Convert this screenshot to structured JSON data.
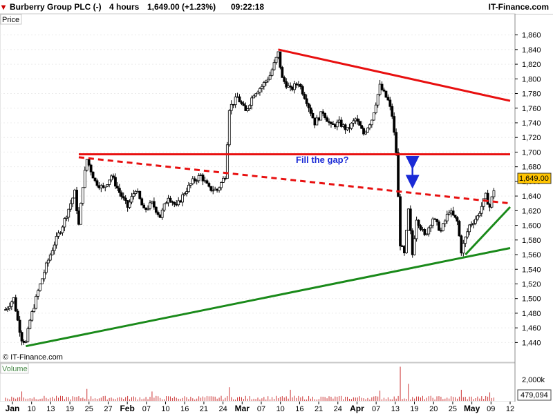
{
  "header": {
    "title": "Burberry Group PLC (-)",
    "timeframe": "4 hours",
    "last": "1,649.00 (+1.23%)",
    "time": "09:22:18",
    "brand": "IT-Finance.com"
  },
  "price_panel": {
    "label": "Price",
    "watermark": "© IT-Finance.com",
    "current_price": "1,649.00",
    "annotation": "Fill the gap?"
  },
  "volume_panel": {
    "label": "Volume",
    "scale_label": "2,000k",
    "current_volume": "479,094"
  },
  "colors": {
    "resistance": "#e81010",
    "support": "#1a8a1a",
    "arrow": "#1a2ad6",
    "annotation": "#1a2ad6",
    "bull_candle": "#ffffff",
    "bear_candle": "#000000",
    "volume_bar": "#cc3333",
    "price_badge": "#ffc400"
  },
  "chart_data": {
    "type": "candlestick",
    "title": "Burberry Group PLC (-)",
    "interval": "4 hours",
    "ylim": [
      1430,
      1870
    ],
    "y_ticks": [
      "1,440",
      "1,460",
      "1,480",
      "1,500",
      "1,520",
      "1,540",
      "1,560",
      "1,580",
      "1,600",
      "1,620",
      "1,640",
      "1,660",
      "1,680",
      "1,700",
      "1,720",
      "1,740",
      "1,760",
      "1,780",
      "1,800",
      "1,820",
      "1,840",
      "1,860"
    ],
    "x_ticks": [
      {
        "label": "Jan",
        "bold": true
      },
      {
        "label": "10"
      },
      {
        "label": "13"
      },
      {
        "label": "19"
      },
      {
        "label": "25"
      },
      {
        "label": "27"
      },
      {
        "label": "Feb",
        "bold": true
      },
      {
        "label": "07"
      },
      {
        "label": "10"
      },
      {
        "label": "16"
      },
      {
        "label": "21"
      },
      {
        "label": "24"
      },
      {
        "label": "Mar",
        "bold": true
      },
      {
        "label": "07"
      },
      {
        "label": "10"
      },
      {
        "label": "16"
      },
      {
        "label": "21"
      },
      {
        "label": "24"
      },
      {
        "label": "Apr",
        "bold": true
      },
      {
        "label": "07"
      },
      {
        "label": "13"
      },
      {
        "label": "19"
      },
      {
        "label": "20"
      },
      {
        "label": "25"
      },
      {
        "label": "May",
        "bold": true
      },
      {
        "label": "09"
      },
      {
        "label": "12"
      }
    ],
    "price_path": [
      {
        "t": 0,
        "p": 1485
      },
      {
        "t": 2,
        "p": 1500
      },
      {
        "t": 3,
        "p": 1470
      },
      {
        "t": 4,
        "p": 1445
      },
      {
        "t": 5,
        "p": 1440
      },
      {
        "t": 6,
        "p": 1470
      },
      {
        "t": 8,
        "p": 1510
      },
      {
        "t": 10,
        "p": 1545
      },
      {
        "t": 12,
        "p": 1575
      },
      {
        "t": 14,
        "p": 1600
      },
      {
        "t": 16,
        "p": 1630
      },
      {
        "t": 17,
        "p": 1645
      },
      {
        "t": 18,
        "p": 1600
      },
      {
        "t": 19,
        "p": 1655
      },
      {
        "t": 20,
        "p": 1690
      },
      {
        "t": 22,
        "p": 1660
      },
      {
        "t": 24,
        "p": 1650
      },
      {
        "t": 26,
        "p": 1668
      },
      {
        "t": 28,
        "p": 1645
      },
      {
        "t": 30,
        "p": 1625
      },
      {
        "t": 32,
        "p": 1650
      },
      {
        "t": 34,
        "p": 1620
      },
      {
        "t": 36,
        "p": 1630
      },
      {
        "t": 38,
        "p": 1612
      },
      {
        "t": 40,
        "p": 1640
      },
      {
        "t": 42,
        "p": 1625
      },
      {
        "t": 44,
        "p": 1645
      },
      {
        "t": 46,
        "p": 1660
      },
      {
        "t": 48,
        "p": 1668
      },
      {
        "t": 50,
        "p": 1650
      },
      {
        "t": 52,
        "p": 1648
      },
      {
        "t": 54,
        "p": 1668
      },
      {
        "t": 55,
        "p": 1760
      },
      {
        "t": 57,
        "p": 1775
      },
      {
        "t": 59,
        "p": 1755
      },
      {
        "t": 61,
        "p": 1780
      },
      {
        "t": 63,
        "p": 1790
      },
      {
        "t": 65,
        "p": 1805
      },
      {
        "t": 67,
        "p": 1835
      },
      {
        "t": 68,
        "p": 1800
      },
      {
        "t": 70,
        "p": 1785
      },
      {
        "t": 72,
        "p": 1795
      },
      {
        "t": 74,
        "p": 1770
      },
      {
        "t": 76,
        "p": 1740
      },
      {
        "t": 78,
        "p": 1755
      },
      {
        "t": 80,
        "p": 1735
      },
      {
        "t": 82,
        "p": 1740
      },
      {
        "t": 84,
        "p": 1730
      },
      {
        "t": 86,
        "p": 1745
      },
      {
        "t": 88,
        "p": 1725
      },
      {
        "t": 90,
        "p": 1745
      },
      {
        "t": 92,
        "p": 1790
      },
      {
        "t": 94,
        "p": 1770
      },
      {
        "t": 95,
        "p": 1750
      },
      {
        "t": 96,
        "p": 1700
      },
      {
        "t": 97,
        "p": 1575
      },
      {
        "t": 98,
        "p": 1560
      },
      {
        "t": 99,
        "p": 1620
      },
      {
        "t": 100,
        "p": 1560
      },
      {
        "t": 101,
        "p": 1610
      },
      {
        "t": 103,
        "p": 1585
      },
      {
        "t": 105,
        "p": 1610
      },
      {
        "t": 107,
        "p": 1592
      },
      {
        "t": 109,
        "p": 1620
      },
      {
        "t": 111,
        "p": 1605
      },
      {
        "t": 112,
        "p": 1565
      },
      {
        "t": 114,
        "p": 1600
      },
      {
        "t": 116,
        "p": 1612
      },
      {
        "t": 118,
        "p": 1640
      },
      {
        "t": 119,
        "p": 1625
      },
      {
        "t": 120,
        "p": 1649
      }
    ],
    "volume_spikes": [
      {
        "t": 4,
        "v": 1.1
      },
      {
        "t": 20,
        "v": 1.4
      },
      {
        "t": 36,
        "v": 1.1
      },
      {
        "t": 55,
        "v": 1.6
      },
      {
        "t": 70,
        "v": 1.3
      },
      {
        "t": 92,
        "v": 1.2
      },
      {
        "t": 97,
        "v": 4.0
      },
      {
        "t": 99,
        "v": 2.0
      },
      {
        "t": 112,
        "v": 1.3
      },
      {
        "t": 119,
        "v": 1.0
      }
    ],
    "volume_max": 4.2,
    "volume_unit": "millions",
    "trendlines": [
      {
        "name": "resistance-horizontal",
        "style": "solid",
        "color": "#e81010",
        "points": [
          {
            "t": 18,
            "p": 1697
          },
          {
            "t": 124,
            "p": 1697
          }
        ]
      },
      {
        "name": "resistance-descending",
        "style": "solid",
        "color": "#e81010",
        "points": [
          {
            "t": 67,
            "p": 1840
          },
          {
            "t": 124,
            "p": 1770
          }
        ]
      },
      {
        "name": "broken-resistance",
        "style": "dashed",
        "color": "#e81010",
        "points": [
          {
            "t": 18,
            "p": 1693
          },
          {
            "t": 124,
            "p": 1630
          }
        ]
      },
      {
        "name": "support-long",
        "style": "solid",
        "color": "#1a8a1a",
        "points": [
          {
            "t": 5,
            "p": 1435
          },
          {
            "t": 124,
            "p": 1569
          }
        ]
      },
      {
        "name": "support-short",
        "style": "solid",
        "color": "#1a8a1a",
        "points": [
          {
            "t": 113,
            "p": 1560
          },
          {
            "t": 124,
            "p": 1625
          }
        ]
      }
    ],
    "gap_arrow": {
      "t": 100,
      "from": 1693,
      "to": 1652
    }
  }
}
